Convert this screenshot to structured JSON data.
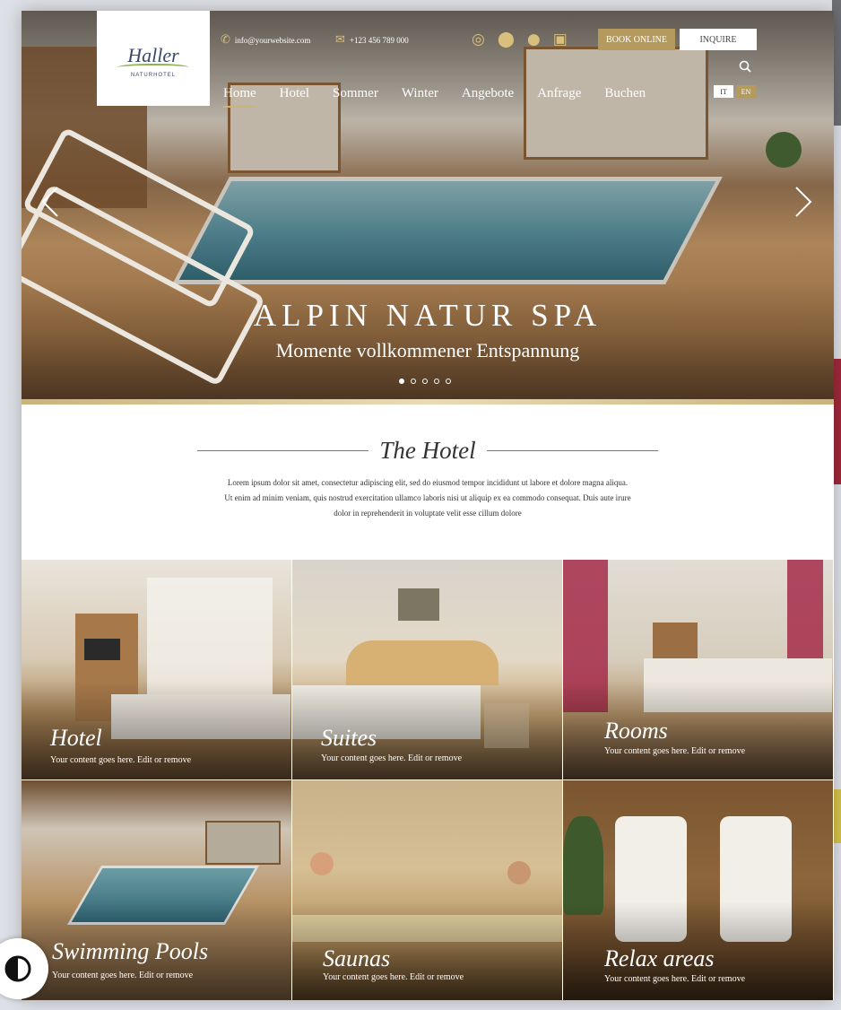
{
  "logo": {
    "name": "Haller",
    "subtitle": "NATURHOTEL"
  },
  "header": {
    "email": "info@yourwebsite.com",
    "phone": "+123 456 789 000",
    "book_label": "BOOK ONLINE",
    "inquire_label": "INQUIRE",
    "social_icons": [
      "whatsapp-icon",
      "location-pin-icon",
      "chat-icon",
      "gift-icon"
    ],
    "lang": {
      "it": "IT",
      "en": "EN",
      "active": "EN"
    }
  },
  "nav": {
    "items": [
      "Home",
      "Hotel",
      "Sommer",
      "Winter",
      "Angebote",
      "Anfrage",
      "Buchen"
    ],
    "active": "Home"
  },
  "hero": {
    "title": "ALPIN NATUR SPA",
    "subtitle": "Momente vollkommener Entspannung",
    "slide_count": 5,
    "active_slide": 1
  },
  "intro": {
    "title": "The Hotel",
    "text": [
      "Lorem ipsum dolor sit amet, consectetur adipiscing elit, sed do eiusmod tempor incididunt ut labore et dolore magna aliqua.",
      "Ut enim ad minim veniam, quis nostrud exercitation ullamco laboris nisi ut aliquip ex ea commodo consequat. Duis aute irure",
      "dolor in reprehenderit in voluptate velit esse cillum dolore"
    ]
  },
  "tiles": [
    {
      "title": "Hotel",
      "desc": "Your content goes here. Edit or remove"
    },
    {
      "title": "Suites",
      "desc": "Your content goes here. Edit or remove"
    },
    {
      "title": "Rooms",
      "desc": "Your content goes here. Edit or remove"
    },
    {
      "title": "Swimming Pools",
      "desc": "Your content goes here. Edit or remove"
    },
    {
      "title": "Saunas",
      "desc": "Your content goes here. Edit or remove"
    },
    {
      "title": "Relax areas",
      "desc": "Your content goes here. Edit or remove"
    }
  ],
  "colors": {
    "gold": "#b49a5c",
    "accent_light": "#d9bf7c",
    "text_dark": "#333333"
  }
}
